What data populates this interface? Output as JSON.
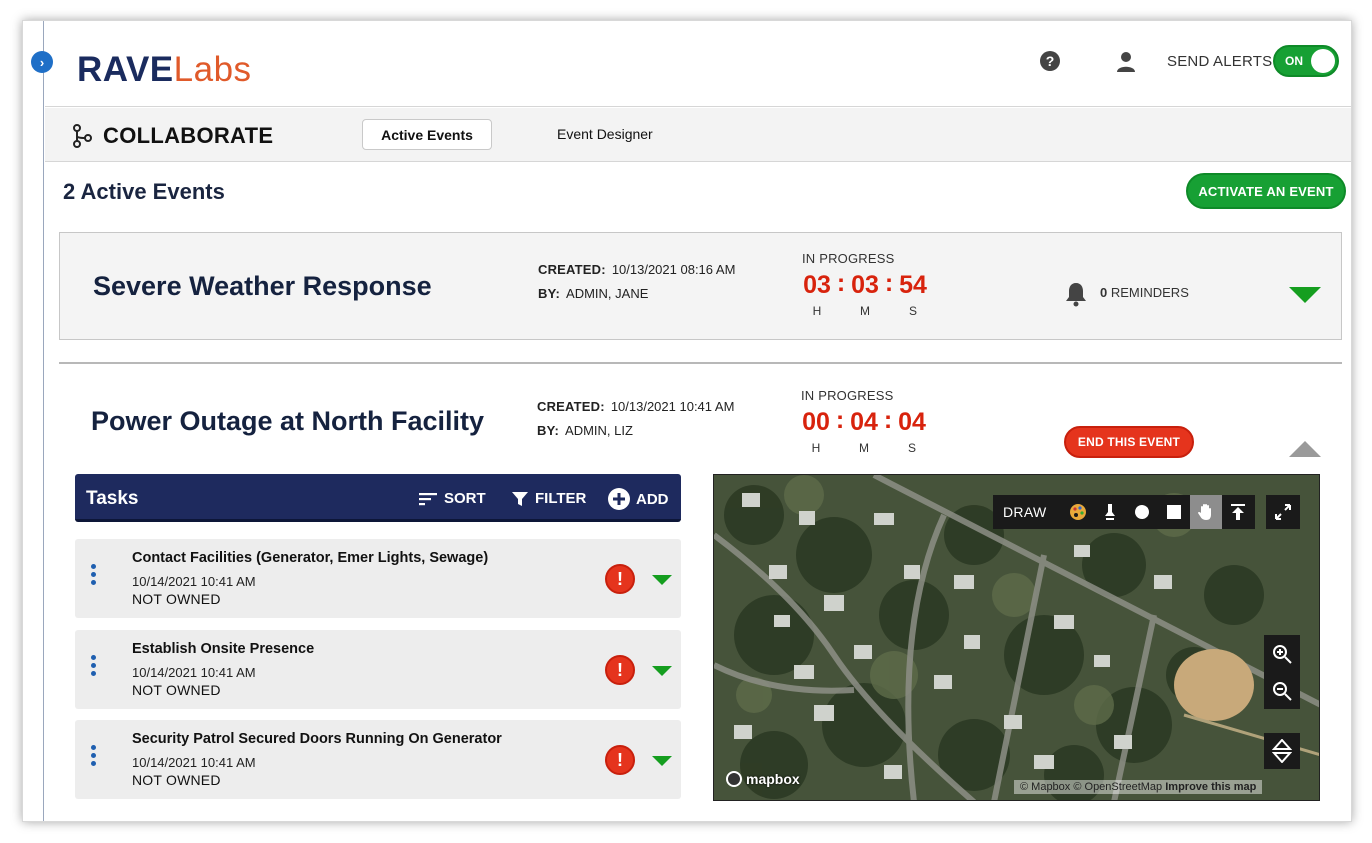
{
  "app": {
    "logo_primary": "RAVE",
    "logo_secondary": "Labs",
    "send_alerts_label": "SEND ALERTS",
    "send_alerts_state": "ON",
    "accent_green": "#17a034",
    "accent_red": "#e5341d",
    "brand_navy": "#1a2b5e"
  },
  "subnav": {
    "section_title": "COLLABORATE",
    "tabs": [
      {
        "label": "Active Events",
        "selected": true
      },
      {
        "label": "Event Designer",
        "selected": false
      }
    ]
  },
  "main": {
    "active_count_label": "2 Active Events",
    "activate_button": "ACTIVATE AN EVENT"
  },
  "events": [
    {
      "title": "Severe Weather Response",
      "created_label": "CREATED:",
      "created_value": "10/13/2021 08:16 AM",
      "by_label": "BY:",
      "by_value": "ADMIN, JANE",
      "status": "IN PROGRESS",
      "timer": {
        "h": "03",
        "m": "03",
        "s": "54"
      },
      "timer_labels": {
        "h": "H",
        "m": "M",
        "s": "S"
      },
      "reminders_count": "0",
      "reminders_label": "REMINDERS"
    },
    {
      "title": "Power Outage at North Facility",
      "created_label": "CREATED:",
      "created_value": "10/13/2021 10:41 AM",
      "by_label": "BY:",
      "by_value": "ADMIN, LIZ",
      "status": "IN PROGRESS",
      "timer": {
        "h": "00",
        "m": "04",
        "s": "04"
      },
      "timer_labels": {
        "h": "H",
        "m": "M",
        "s": "S"
      },
      "end_button": "END THIS EVENT"
    }
  ],
  "tasks": {
    "title": "Tasks",
    "sort_label": "SORT",
    "filter_label": "FILTER",
    "add_label": "ADD",
    "items": [
      {
        "title": "Contact Facilities (Generator, Emer Lights, Sewage)",
        "date": "10/14/2021 10:41 AM",
        "owner": "NOT OWNED"
      },
      {
        "title": "Establish Onsite Presence",
        "date": "10/14/2021 10:41 AM",
        "owner": "NOT OWNED"
      },
      {
        "title": "Security Patrol Secured Doors Running On Generator",
        "date": "10/14/2021 10:41 AM",
        "owner": "NOT OWNED"
      }
    ]
  },
  "map": {
    "draw_label": "DRAW",
    "tools": [
      "palette-icon",
      "pen-icon",
      "circle-icon",
      "square-icon",
      "hand-icon",
      "upload-icon"
    ],
    "logo_text": "mapbox",
    "attribution_a": "© Mapbox © OpenStreetMap",
    "attribution_b": "Improve this map"
  }
}
